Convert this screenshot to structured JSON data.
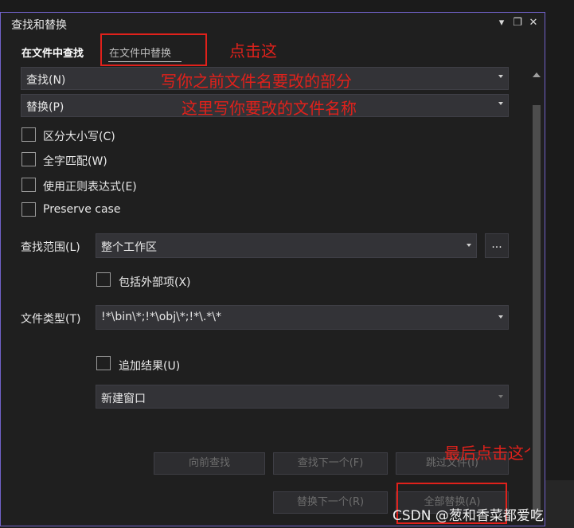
{
  "window": {
    "title": "查找和替换",
    "controls": [
      "▾",
      "❐",
      "✕"
    ]
  },
  "tabs": [
    {
      "label": "在文件中查找",
      "active": true
    },
    {
      "label": "在文件中替换",
      "active": false
    }
  ],
  "find": {
    "value": "查找(N)"
  },
  "replace": {
    "value": "替换(P)"
  },
  "options": [
    {
      "label": "区分大小写(C)",
      "checked": false
    },
    {
      "label": "全字匹配(W)",
      "checked": false
    },
    {
      "label": "使用正则表达式(E)",
      "checked": false
    },
    {
      "label": "Preserve case",
      "checked": false
    }
  ],
  "scope": {
    "label": "查找范围(L)",
    "value": "整个工作区",
    "browse": "..."
  },
  "include_external": {
    "label": "包括外部项(X)",
    "checked": false
  },
  "file_types": {
    "label": "文件类型(T)",
    "value": "!*\\bin\\*;!*\\obj\\*;!*\\.*\\*"
  },
  "append_results": {
    "label": "追加结果(U)",
    "checked": false
  },
  "output": {
    "value": "新建窗口"
  },
  "buttons": {
    "find_prev": "向前查找",
    "find_next": "查找下一个(F)",
    "skip_file": "跳过文件(I)",
    "replace_next": "替换下一个(R)",
    "replace_all": "全部替换(A)"
  },
  "annotations": {
    "click_here": "点击这",
    "find_hint": "写你之前文件名要改的部分",
    "replace_hint": "这里写你要改的文件名称",
    "finally_click": "最后点击这个"
  },
  "watermark": "CSDN @葱和香菜都爱吃",
  "colors": {
    "annotation": "#e0211b",
    "border_accent": "#7162c9"
  }
}
